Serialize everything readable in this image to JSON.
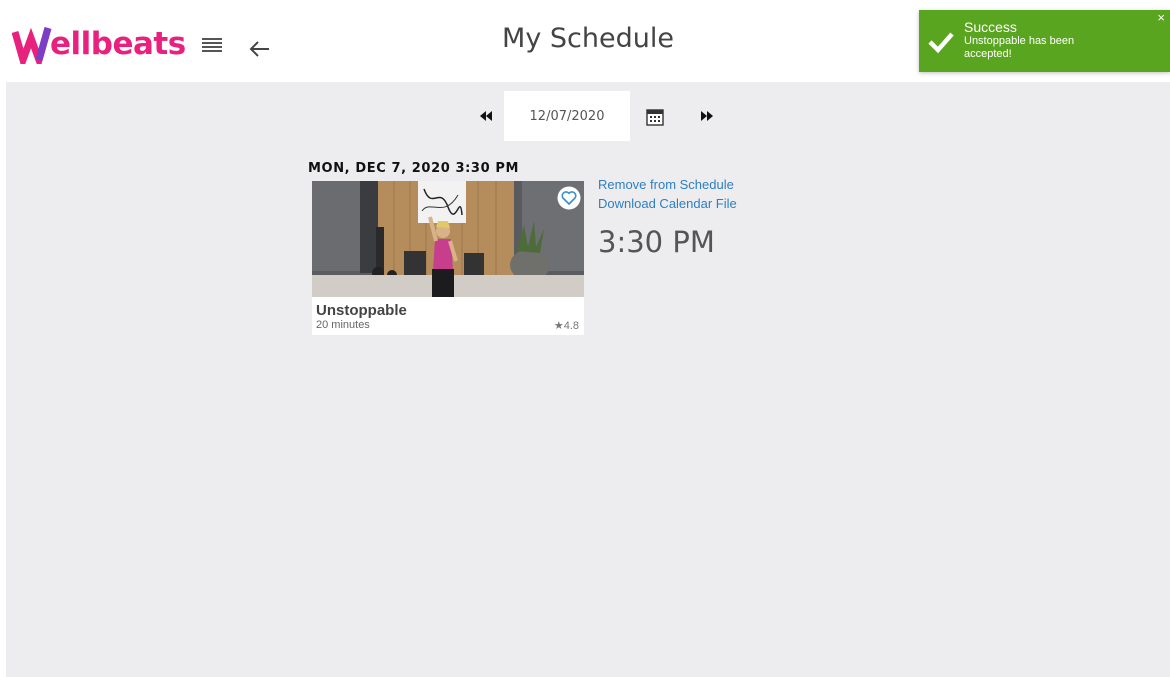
{
  "brand": {
    "logo_text": "ellbeats",
    "logo_initial": "W",
    "color": "#e8207e"
  },
  "header": {
    "title": "My Schedule"
  },
  "toast": {
    "title": "Success",
    "message": "Unstoppable has been accepted!",
    "close": "×",
    "color": "#5aa520"
  },
  "date_nav": {
    "date_value": "12/07/2020",
    "prev_icon": "double-chevron-left-icon",
    "next_icon": "double-chevron-right-icon",
    "calendar_icon": "calendar-icon"
  },
  "schedule": {
    "day_heading": "MON, DEC 7, 2020 3:30 PM",
    "item": {
      "name": "Unstoppable",
      "duration": "20 minutes",
      "rating": "4.8",
      "time": "3:30 PM",
      "actions": {
        "remove": "Remove from Schedule",
        "download": "Download Calendar File"
      }
    }
  }
}
